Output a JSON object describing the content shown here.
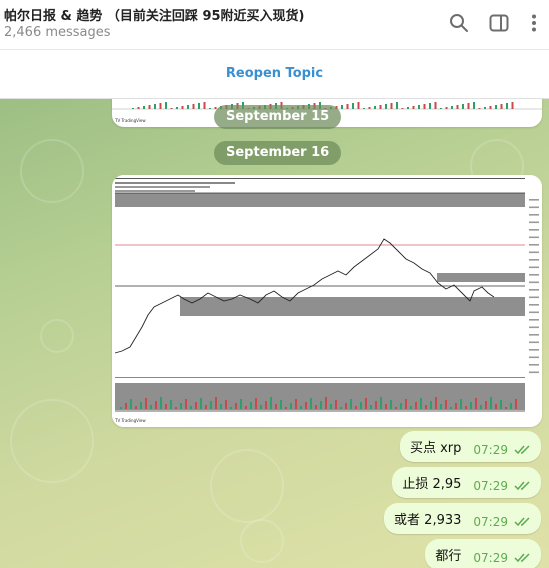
{
  "header": {
    "title": "帕尔日报 & 趋势 （目前关注回踩 95附近买入现货)",
    "subtitle": "2,466 messages",
    "icons": [
      "search-icon",
      "sidebar-toggle-icon",
      "more-vertical-icon"
    ]
  },
  "reopen": {
    "label": "Reopen Topic"
  },
  "dates": {
    "first": "September 15",
    "second": "September 16"
  },
  "chart_top": {
    "watermark": "TV TradingView"
  },
  "chart_main": {
    "watermark": "TV TradingView",
    "line_color": "#222222",
    "zone_color": "#8f8f8f",
    "red_line_color": "#d86060"
  },
  "messages": [
    {
      "text": "买点 xrp",
      "time": "07:29"
    },
    {
      "text": "止损 2,95",
      "time": "07:29"
    },
    {
      "text": "或者 2,933",
      "time": "07:29"
    },
    {
      "text": "都行",
      "time": "07:29"
    }
  ],
  "colors": {
    "accent": "#3a8fd0",
    "bubble": "#eefdd9",
    "time": "#5caa52"
  }
}
